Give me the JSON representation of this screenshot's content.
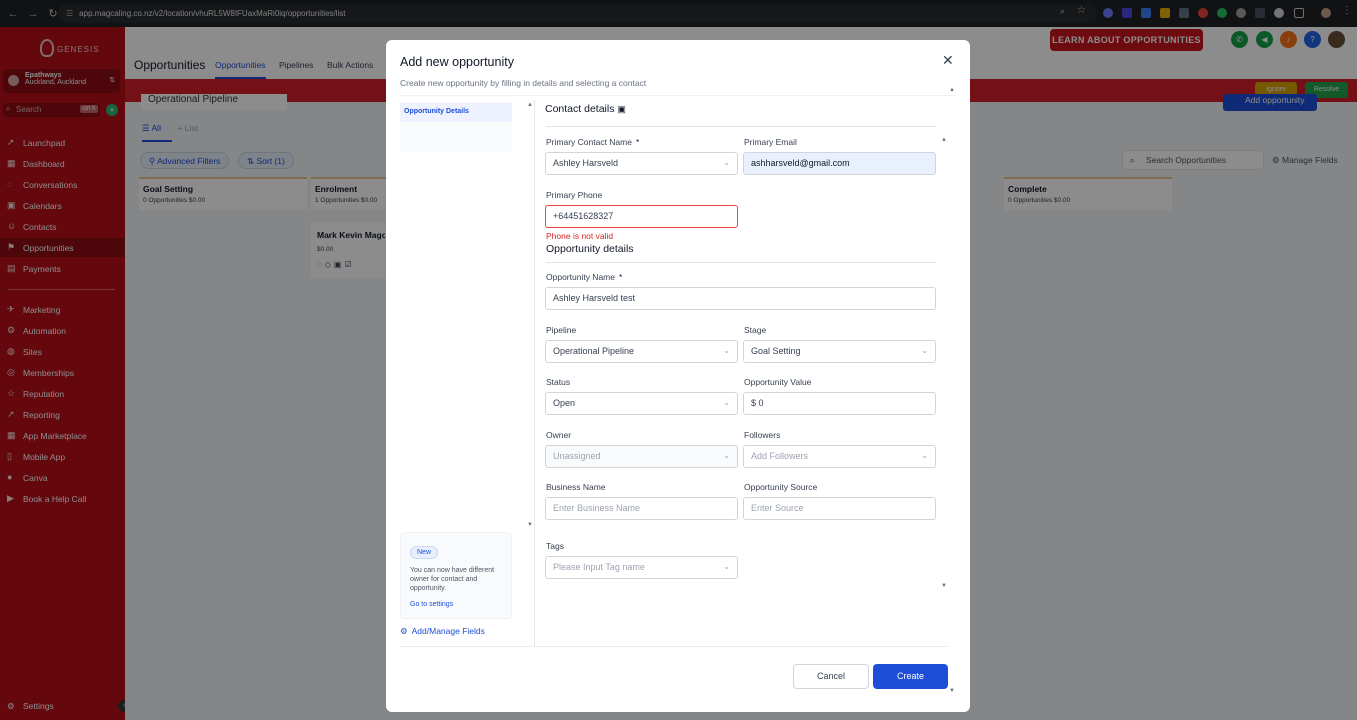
{
  "browser": {
    "url": "app.magcaling.co.nz/v2/location/vhuRL5W8IFUaxMaRi0iq/opportunities/list"
  },
  "sidebar": {
    "logo_text": "GENESIS",
    "account_name": "Epathways",
    "account_location": "Auckland, Auckland",
    "search_placeholder": "Search",
    "search_shortcut": "ctrl K",
    "items": [
      {
        "label": "Launchpad",
        "icon": "rocket-icon"
      },
      {
        "label": "Dashboard",
        "icon": "dashboard-icon"
      },
      {
        "label": "Conversations",
        "icon": "chat-icon"
      },
      {
        "label": "Calendars",
        "icon": "calendar-icon"
      },
      {
        "label": "Contacts",
        "icon": "contacts-icon"
      },
      {
        "label": "Opportunities",
        "icon": "opportunities-icon"
      },
      {
        "label": "Payments",
        "icon": "payments-icon"
      },
      {
        "label": "Marketing",
        "icon": "marketing-icon"
      },
      {
        "label": "Automation",
        "icon": "automation-icon"
      },
      {
        "label": "Sites",
        "icon": "sites-icon"
      },
      {
        "label": "Memberships",
        "icon": "memberships-icon"
      },
      {
        "label": "Reputation",
        "icon": "star-icon"
      },
      {
        "label": "Reporting",
        "icon": "reporting-icon"
      },
      {
        "label": "App Marketplace",
        "icon": "marketplace-icon"
      },
      {
        "label": "Mobile App",
        "icon": "mobile-icon"
      },
      {
        "label": "Canva",
        "icon": "canva-icon"
      },
      {
        "label": "Book a Help Call",
        "icon": "help-call-icon"
      }
    ],
    "settings_label": "Settings"
  },
  "topbar": {
    "title": "Opportunities",
    "tabs": [
      "Opportunities",
      "Pipelines",
      "Bulk Actions"
    ],
    "learn_button": "LEARN ABOUT OPPORTUNITIES"
  },
  "banner": {
    "ignore_label": "Ignore",
    "resolve_label": "Resolve"
  },
  "board": {
    "pipeline_selected": "Operational Pipeline",
    "views": {
      "all": "All",
      "list": "List"
    },
    "filters": {
      "advanced": "Advanced Filters",
      "sort": "Sort (1)"
    },
    "search_placeholder": "Search Opportunities",
    "manage_fields": "Manage Fields",
    "add_button": "Add opportunity",
    "stages": [
      {
        "name": "Goal Setting",
        "summary": "0 Opportunities   $0.00"
      },
      {
        "name": "Enrolment",
        "summary": "1 Opportunities   $0.00"
      },
      {
        "name": "Complete",
        "summary": "0 Opportunities   $0.00"
      }
    ],
    "card": {
      "name": "Mark Kevin Magcaling",
      "value": "$0.00",
      "badge": "1"
    }
  },
  "modal": {
    "title": "Add new opportunity",
    "subtitle": "Create new opportunity by filling in details and selecting a contact",
    "left_tab": "Opportunity Details",
    "new_card": {
      "pill": "New",
      "text": "You can now have different owner for contact and opportunity.",
      "link": "Go to settings"
    },
    "add_manage_fields": "Add/Manage Fields",
    "contact_section": "Contact details",
    "primary_contact_label": "Primary Contact Name",
    "primary_contact_value": "Ashley Harsveld",
    "primary_email_label": "Primary Email",
    "primary_email_value": "ashharsveld@gmail.com",
    "primary_phone_label": "Primary Phone",
    "primary_phone_value": "+64451628327",
    "phone_error": "Phone is not valid",
    "opportunity_section": "Opportunity details",
    "opp_name_label": "Opportunity Name",
    "opp_name_value": "Ashley Harsveld test",
    "pipeline_label": "Pipeline",
    "pipeline_value": "Operational Pipeline",
    "stage_label": "Stage",
    "stage_value": "Goal Setting",
    "status_label": "Status",
    "status_value": "Open",
    "value_label": "Opportunity Value",
    "value_value": "$ 0",
    "owner_label": "Owner",
    "owner_placeholder": "Unassigned",
    "followers_label": "Followers",
    "followers_placeholder": "Add Followers",
    "business_label": "Business Name",
    "business_placeholder": "Enter Business Name",
    "source_label": "Opportunity Source",
    "source_placeholder": "Enter Source",
    "tags_label": "Tags",
    "tags_placeholder": "Please Input Tag name",
    "required_mark": "*",
    "cancel": "Cancel",
    "create": "Create"
  },
  "colors": {
    "sidebar": "#b8101a",
    "primary": "#1d4ed8",
    "error": "#dc2626"
  }
}
